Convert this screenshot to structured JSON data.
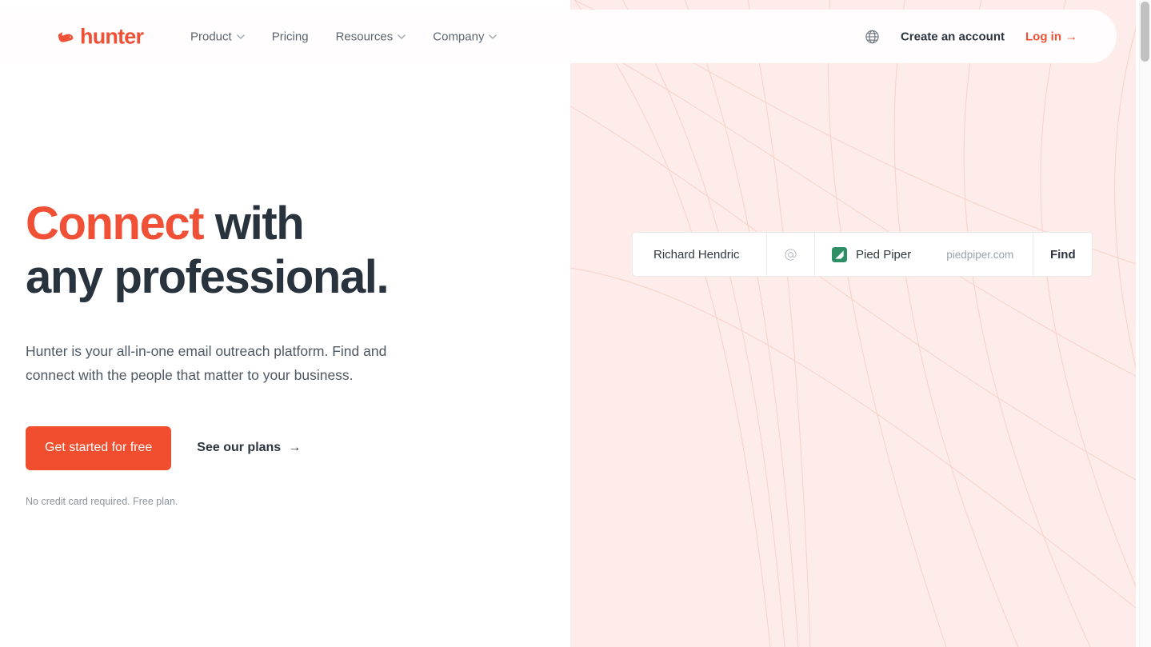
{
  "brand": {
    "name": "hunter",
    "logo_icon": "hunter-animal-head-icon",
    "accent_color": "#f05136",
    "dark_color": "#29333d"
  },
  "header": {
    "nav_links": [
      {
        "label": "Product",
        "has_dropdown": true,
        "icon": "chevron-down-icon"
      },
      {
        "label": "Pricing",
        "has_dropdown": false,
        "icon": ""
      },
      {
        "label": "Resources",
        "has_dropdown": true,
        "icon": "chevron-down-icon"
      },
      {
        "label": "Company",
        "has_dropdown": true,
        "icon": "chevron-down-icon"
      }
    ],
    "language_icon": "globe-icon",
    "create_account_label": "Create an account",
    "login_label": "Log in",
    "login_arrow": "→"
  },
  "hero": {
    "headline_accent": "Connect",
    "headline_rest": " with",
    "headline_line2": "any professional.",
    "subhead": "Hunter is your all-in-one email outreach platform. Find and connect with the people that matter to your business.",
    "primary_cta": "Get started for free",
    "secondary_cta": "See our plans",
    "secondary_cta_arrow": "→",
    "fineprint": "No credit card required. Free plan."
  },
  "search_widget": {
    "name_value": "Richard Hendric",
    "at_icon": "at-sign-icon",
    "company_logo_icon": "pied-piper-logo-icon",
    "company_value": "Pied Piper",
    "domain_value": "piedpiper.com",
    "find_label": "Find"
  },
  "scrollbar": {
    "orientation": "vertical",
    "thumb_position": "top"
  }
}
